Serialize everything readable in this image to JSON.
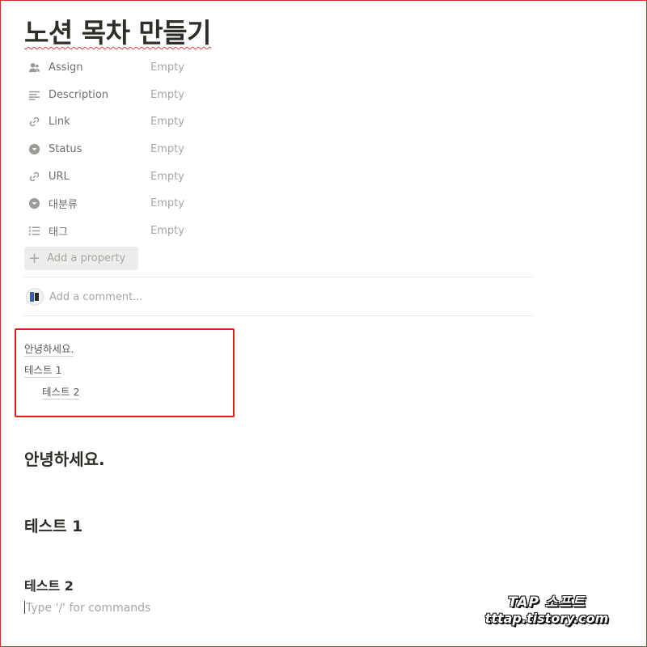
{
  "page": {
    "title": "노션 목차 만들기"
  },
  "properties": [
    {
      "label": "Assign",
      "value": "Empty",
      "icon": "person-icon"
    },
    {
      "label": "Description",
      "value": "Empty",
      "icon": "text-lines-icon"
    },
    {
      "label": "Link",
      "value": "Empty",
      "icon": "link-icon"
    },
    {
      "label": "Status",
      "value": "Empty",
      "icon": "select-icon"
    },
    {
      "label": "URL",
      "value": "Empty",
      "icon": "link-icon"
    },
    {
      "label": "대분류",
      "value": "Empty",
      "icon": "select-icon"
    },
    {
      "label": "태그",
      "value": "Empty",
      "icon": "list-icon"
    }
  ],
  "add_property": {
    "label": "Add a property",
    "icon": "plus-icon"
  },
  "comment": {
    "placeholder": "Add a comment..."
  },
  "toc": {
    "items": [
      "안녕하세요.",
      "테스트 1",
      "테스트 2"
    ],
    "highlight_color": "#e11e1e"
  },
  "headings": [
    "안녕하세요.",
    "테스트 1",
    "테스트 2"
  ],
  "editor": {
    "placeholder": "Type '/' for commands"
  },
  "watermark": {
    "line1": "TAP 소프트",
    "line2": "tttap.tistory.com"
  }
}
